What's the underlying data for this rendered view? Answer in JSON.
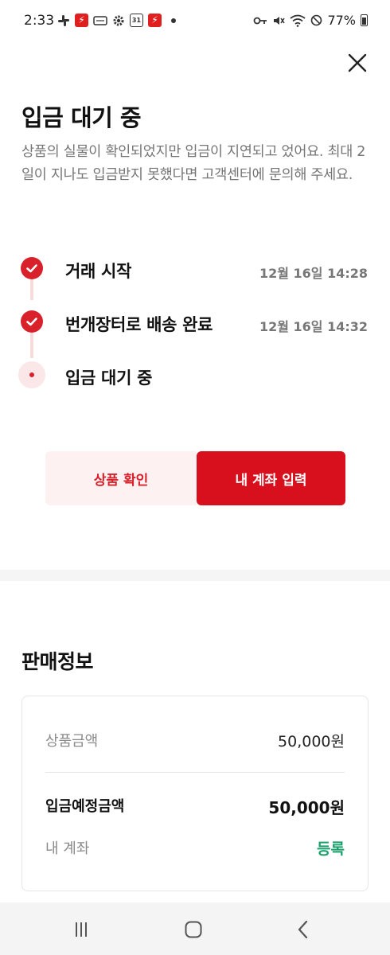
{
  "status_bar": {
    "time": "2:33",
    "calendar_day": "31",
    "battery": "77%"
  },
  "header": {
    "title": "입금 대기 중",
    "description": "상품의 실물이 확인되었지만 입금이 지연되고 었어요. 최대 2일이 지나도 입금받지 못했다면 고객센터에 문의해 주세요."
  },
  "timeline": {
    "steps": [
      {
        "label": "거래 시작",
        "time": "12월 16일 14:28",
        "status": "done"
      },
      {
        "label": "번개장터로 배송 완료",
        "time": "12월 16일 14:32",
        "status": "done"
      },
      {
        "label": "입금 대기 중",
        "time": "",
        "status": "pending"
      }
    ]
  },
  "actions": {
    "secondary_label": "상품 확인",
    "primary_label": "내 계좌 입력"
  },
  "sale_info": {
    "title": "판매정보",
    "price_label": "상품금액",
    "price_value": "50,000원",
    "expected_label": "입금예정금액",
    "expected_value": "50,000원",
    "account_label": "내 계좌",
    "account_action": "등록"
  },
  "colors": {
    "accent": "#d8101d",
    "accent_soft": "#fdf1f1",
    "success": "#1aa06b"
  },
  "icons": {
    "close": "close-icon",
    "check": "check-icon",
    "nav_recent": "recent-apps-icon",
    "nav_home": "home-icon",
    "nav_back": "back-icon"
  }
}
